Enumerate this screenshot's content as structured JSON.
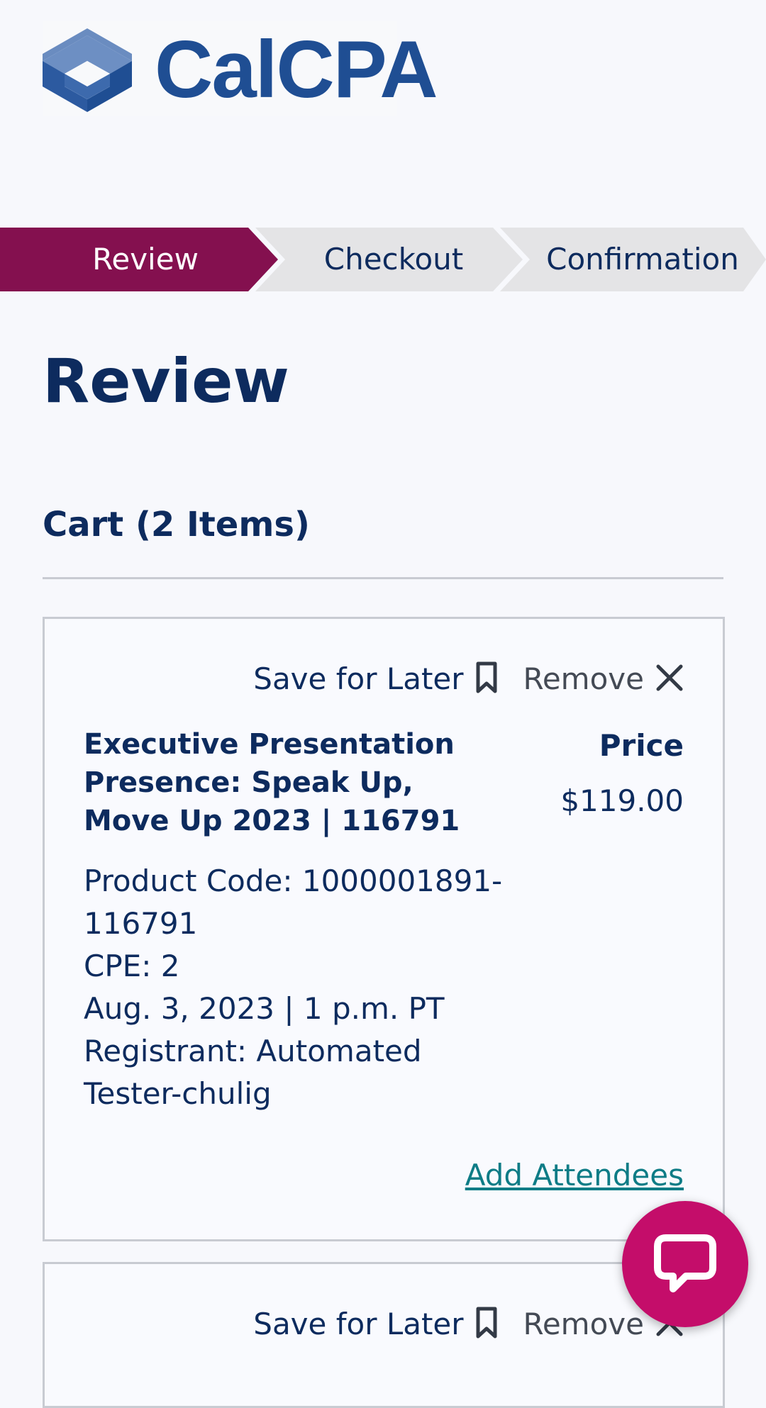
{
  "header": {
    "logo_text": "CalCPA",
    "brand_color": "#1f4e93"
  },
  "steps": [
    {
      "label": "Review",
      "active": true
    },
    {
      "label": "Checkout",
      "active": false
    },
    {
      "label": "Confirmation",
      "active": false
    }
  ],
  "colors": {
    "step_active": "#84104f",
    "step_inactive": "#e4e4e6",
    "text_primary": "#0d2b5e",
    "link": "#0e7c86",
    "chat": "#c40d6a"
  },
  "page": {
    "title": "Review",
    "cart_heading": "Cart (2 Items)"
  },
  "cart": {
    "save_for_later_label": "Save for Later",
    "remove_label": "Remove",
    "price_label": "Price",
    "items": [
      {
        "title": "Executive Presentation Presence: Speak Up, Move Up 2023 | 116791",
        "product_code_line1": "Product Code: 1000001891-",
        "product_code_line2": "116791",
        "cpe": "CPE: 2",
        "date": "Aug. 3, 2023 | 1 p.m. PT",
        "registrant_line1": "Registrant: Automated",
        "registrant_line2": "Tester-chulig",
        "price": "$119.00",
        "add_attendees_label": "Add Attendees"
      }
    ]
  },
  "icons": {
    "bookmark": "bookmark-icon",
    "close": "close-icon",
    "chat": "chat-icon",
    "logo_mark": "calcpa-logo-mark"
  }
}
